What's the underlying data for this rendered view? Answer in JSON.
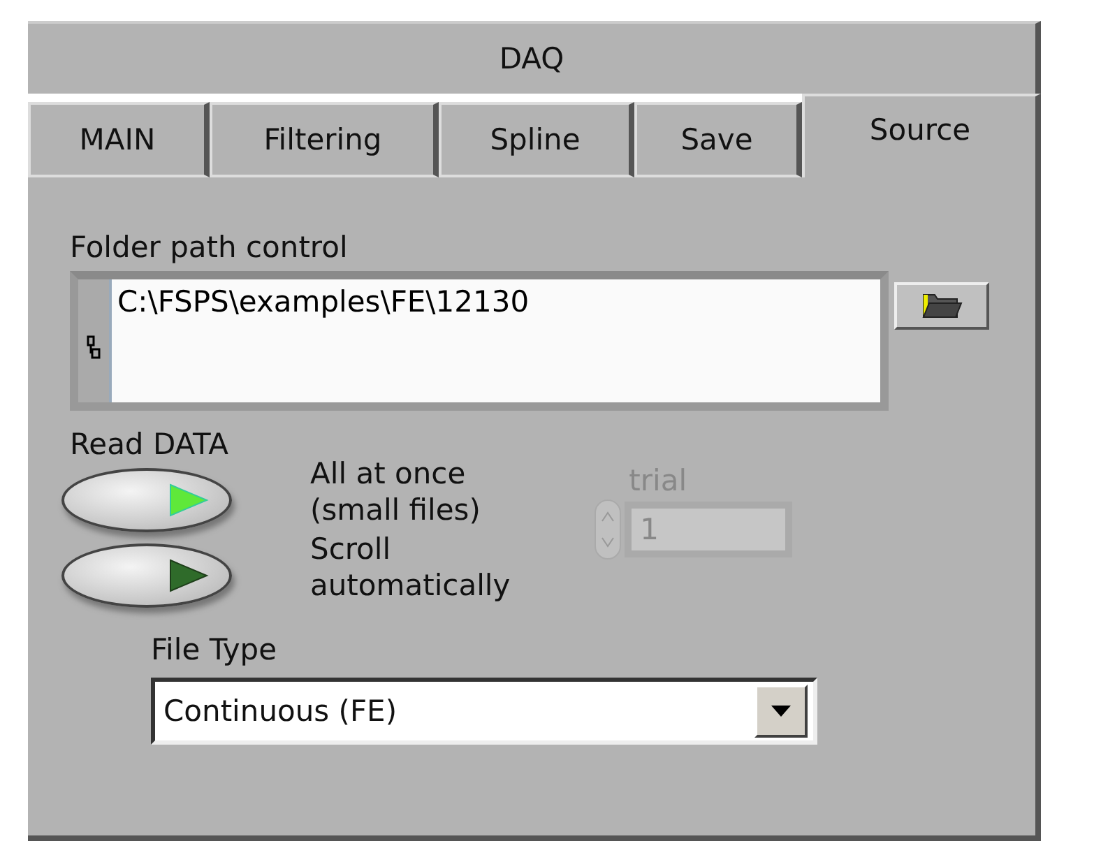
{
  "panel": {
    "title": "DAQ"
  },
  "tabs": [
    {
      "label": "MAIN",
      "selected": false
    },
    {
      "label": "Filtering",
      "selected": false
    },
    {
      "label": "Spline",
      "selected": false
    },
    {
      "label": "Save",
      "selected": false
    },
    {
      "label": "Source",
      "selected": true
    }
  ],
  "folder_path": {
    "label": "Folder path control",
    "value": "C:\\FSPS\\examples\\FE\\12130"
  },
  "read_data": {
    "label": "Read DATA",
    "buttons": [
      {
        "label": "All at once\n(small files)",
        "on": true
      },
      {
        "label": "Scroll\nautomatically",
        "on": false
      }
    ]
  },
  "trial": {
    "label": "trial",
    "value": "1",
    "disabled": true
  },
  "file_type": {
    "label": "File Type",
    "value": "Continuous (FE)"
  }
}
